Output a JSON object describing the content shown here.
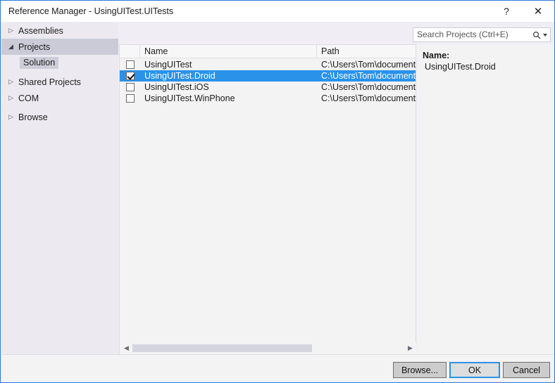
{
  "window": {
    "title": "Reference Manager - UsingUITest.UITests",
    "help_glyph": "?",
    "close_glyph": "✕",
    "accent_color": "#2b7cd3"
  },
  "search": {
    "placeholder": "Search Projects (Ctrl+E)",
    "value": "",
    "icon": "search-icon",
    "dropdown_icon": "chevron-down-icon"
  },
  "sidebar": {
    "items": [
      {
        "label": "Assemblies",
        "expanded": false,
        "selected": false,
        "glyph": "▷"
      },
      {
        "label": "Projects",
        "expanded": true,
        "selected": true,
        "glyph": "◢"
      },
      {
        "label": "Shared Projects",
        "expanded": false,
        "selected": false,
        "glyph": "▷"
      },
      {
        "label": "COM",
        "expanded": false,
        "selected": false,
        "glyph": "▷"
      },
      {
        "label": "Browse",
        "expanded": false,
        "selected": false,
        "glyph": "▷"
      }
    ],
    "sub_item": {
      "label": "Solution",
      "selected": true
    }
  },
  "list": {
    "columns": [
      "",
      "Name",
      "Path"
    ],
    "rows": [
      {
        "checked": false,
        "name": "UsingUITest",
        "path": "C:\\Users\\Tom\\document",
        "selected": false
      },
      {
        "checked": true,
        "name": "UsingUITest.Droid",
        "path": "C:\\Users\\Tom\\document",
        "selected": true
      },
      {
        "checked": false,
        "name": "UsingUITest.iOS",
        "path": "C:\\Users\\Tom\\document",
        "selected": false
      },
      {
        "checked": false,
        "name": "UsingUITest.WinPhone",
        "path": "C:\\Users\\Tom\\document",
        "selected": false
      }
    ],
    "scroll_left_glyph": "◀",
    "scroll_right_glyph": "▶",
    "selection_color": "#2a92e8"
  },
  "detail": {
    "label": "Name:",
    "value": "UsingUITest.Droid"
  },
  "footer": {
    "browse_label": "Browse...",
    "ok_label": "OK",
    "cancel_label": "Cancel"
  }
}
